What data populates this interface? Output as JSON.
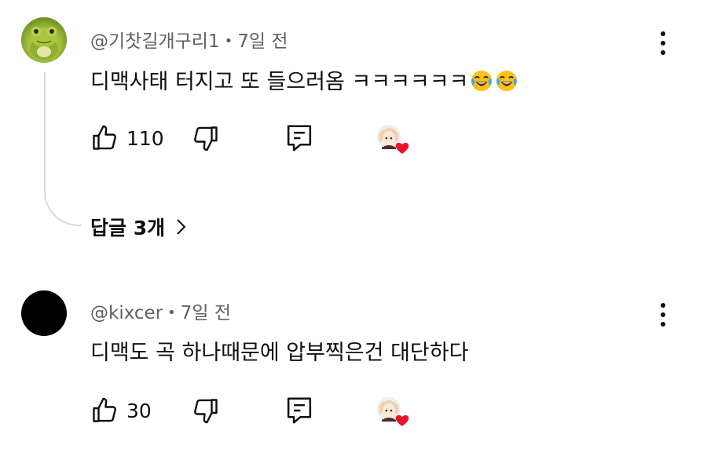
{
  "comments": [
    {
      "author": "@기찻길개구리1",
      "separator": "•",
      "time": "7일 전",
      "text": "디맥사태 터지고 또 들으러옴 ㅋㅋㅋㅋㅋㅋ",
      "emojis": [
        "face-with-tears-of-joy-icon",
        "face-with-tears-of-joy-icon"
      ],
      "likes": "110",
      "avatar": "frog-avatar",
      "replies_label": "답글 3개"
    },
    {
      "author": "@kixcer",
      "separator": "•",
      "time": "7일 전",
      "text": "디맥도 곡 하나때문에 압부찍은건 대단하다",
      "likes": "30",
      "avatar": "black-avatar"
    }
  ],
  "icons": {
    "like": "thumbs-up-icon",
    "dislike": "thumbs-down-icon",
    "reply": "reply-icon",
    "creator_heart": "creator-heart-icon",
    "more": "more-vertical-icon",
    "replies_chevron": "chevron-right-icon"
  },
  "colors": {
    "primary_text": "#0f0f0f",
    "secondary_text": "#606060",
    "heart": "#e8132b",
    "thread_line": "#d9d9d9"
  }
}
